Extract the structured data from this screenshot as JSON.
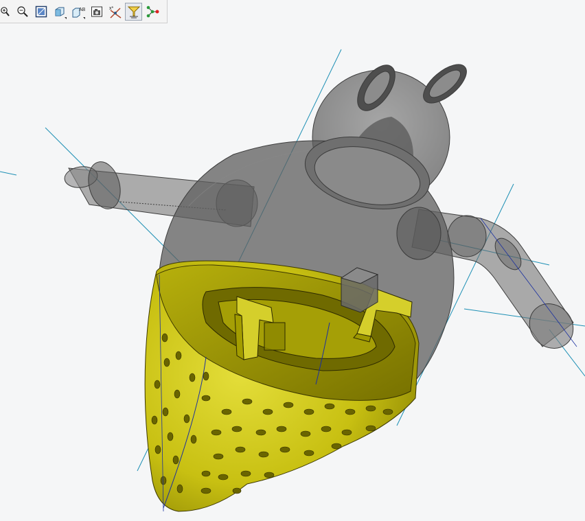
{
  "toolbar": {
    "buttons": [
      {
        "name": "zoom-in-icon",
        "active": false
      },
      {
        "name": "zoom-out-icon",
        "active": false
      },
      {
        "name": "zoom-window-icon",
        "active": false
      },
      {
        "name": "view-orientation-icon",
        "active": false
      },
      {
        "name": "named-views-icon",
        "active": false
      },
      {
        "name": "camera-snapshot-icon",
        "active": false
      },
      {
        "name": "datum-display-icon",
        "active": false
      },
      {
        "name": "plane-filter-icon",
        "active": true
      },
      {
        "name": "network-graph-icon",
        "active": false
      }
    ]
  },
  "model": {
    "shell_color": "#5e5e5e",
    "strainer_color": "#cfc915",
    "strainer_dark": "#8f8a00",
    "axis_color": "#1c8fb4"
  }
}
